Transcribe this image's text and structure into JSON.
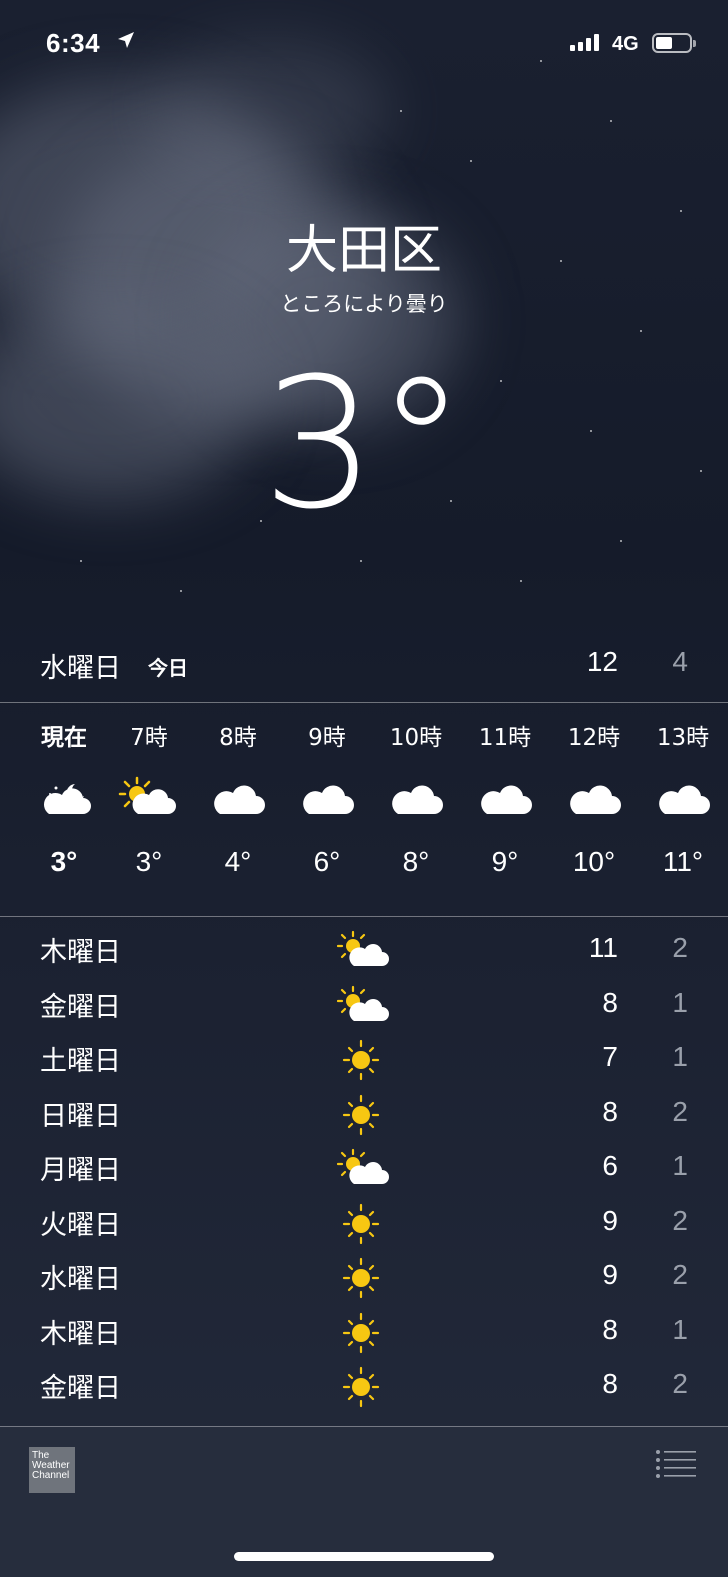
{
  "status_bar": {
    "time": "6:34",
    "network": "4G"
  },
  "location": {
    "city": "大田区",
    "condition": "ところにより曇り",
    "current_temp": "3°"
  },
  "today": {
    "day": "水曜日",
    "label": "今日",
    "high": "12",
    "low": "4"
  },
  "hourly": [
    {
      "label": "現在",
      "icon": "moon-cloud-icon",
      "temp": "3°"
    },
    {
      "label": "7時",
      "icon": "sun-cloud-icon",
      "temp": "3°"
    },
    {
      "label": "8時",
      "icon": "cloud-icon",
      "temp": "4°"
    },
    {
      "label": "9時",
      "icon": "cloud-icon",
      "temp": "6°"
    },
    {
      "label": "10時",
      "icon": "cloud-icon",
      "temp": "8°"
    },
    {
      "label": "11時",
      "icon": "cloud-icon",
      "temp": "9°"
    },
    {
      "label": "12時",
      "icon": "cloud-icon",
      "temp": "10°"
    },
    {
      "label": "13時",
      "icon": "cloud-icon",
      "temp": "11°"
    }
  ],
  "daily": [
    {
      "day": "木曜日",
      "icon": "sun-cloud-icon",
      "high": "11",
      "low": "2"
    },
    {
      "day": "金曜日",
      "icon": "sun-cloud-icon",
      "high": "8",
      "low": "1"
    },
    {
      "day": "土曜日",
      "icon": "sun-icon",
      "high": "7",
      "low": "1"
    },
    {
      "day": "日曜日",
      "icon": "sun-icon",
      "high": "8",
      "low": "2"
    },
    {
      "day": "月曜日",
      "icon": "sun-cloud-icon",
      "high": "6",
      "low": "1"
    },
    {
      "day": "火曜日",
      "icon": "sun-icon",
      "high": "9",
      "low": "2"
    },
    {
      "day": "水曜日",
      "icon": "sun-icon",
      "high": "9",
      "low": "2"
    },
    {
      "day": "木曜日",
      "icon": "sun-icon",
      "high": "8",
      "low": "1"
    },
    {
      "day": "金曜日",
      "icon": "sun-icon",
      "high": "8",
      "low": "2"
    }
  ],
  "footer": {
    "logo_text": "The Weather Channel"
  },
  "colors": {
    "sun": "#f7c712",
    "low_temp": "#9aa0ab",
    "background": "#1a2030"
  }
}
